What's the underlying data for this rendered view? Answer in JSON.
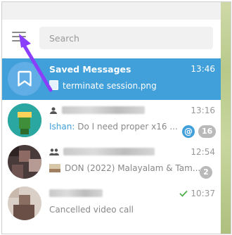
{
  "search": {
    "placeholder": "Search"
  },
  "chats": [
    {
      "title": "Saved Messages",
      "time": "13:46",
      "preview": "terminate session.png"
    },
    {
      "time": "13:16",
      "sender": "Ishan:",
      "preview": "Do I need proper x16 ...",
      "mention_badge": "@",
      "unread": "16"
    },
    {
      "time": "12:54",
      "preview": "DON (2022) Malayalam & Tam...",
      "unread": "2"
    },
    {
      "time": "10:37",
      "preview": "Cancelled video call"
    }
  ],
  "colors": {
    "accent": "#419fd9",
    "annotation_arrow": "#8a3ffc",
    "muted_badge": "#b9b9b9"
  },
  "icons": [
    "menu-icon",
    "bookmark-icon",
    "file-icon",
    "contact-icon",
    "group-icon",
    "image-thumb-icon",
    "check-icon"
  ]
}
